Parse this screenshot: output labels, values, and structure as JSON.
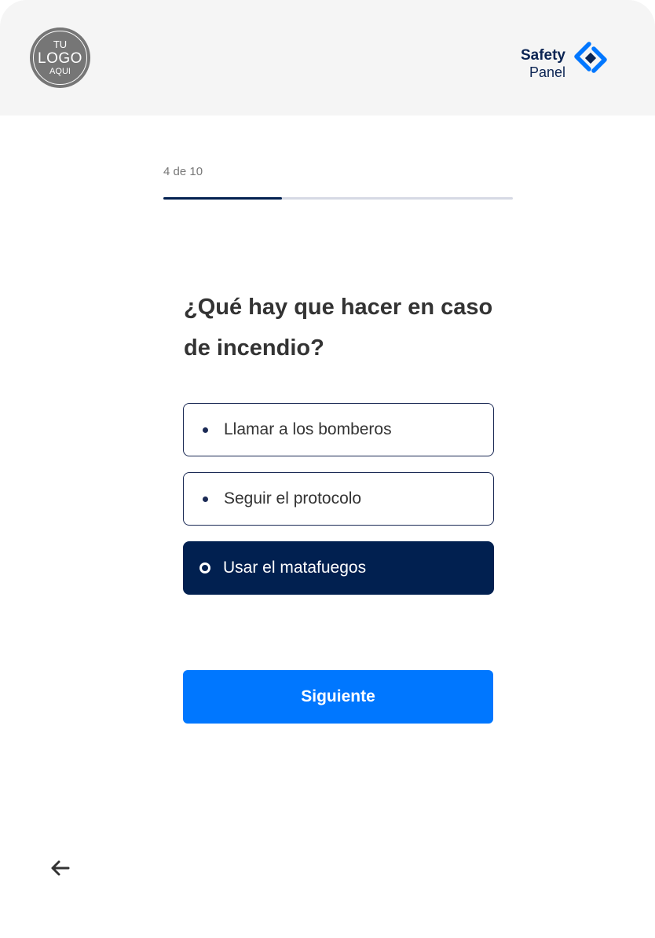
{
  "header": {
    "client_logo": {
      "line1": "TU",
      "line2": "LOGO",
      "line3": "AQUI"
    },
    "brand": {
      "name": "Safety",
      "sub": "Panel",
      "icon": "safety-panel-diamond-icon",
      "accent": "#0077ff"
    }
  },
  "progress": {
    "label": "4 de 10",
    "current": 4,
    "total": 10,
    "fraction": 0.34
  },
  "question": {
    "text": "¿Qué hay que hacer en caso de incendio?"
  },
  "options": [
    {
      "label": "Llamar a los bomberos",
      "selected": false
    },
    {
      "label": "Seguir el protocolo",
      "selected": false
    },
    {
      "label": "Usar el matafuegos",
      "selected": true
    }
  ],
  "actions": {
    "next_label": "Siguiente",
    "back_icon": "arrow-left-icon"
  },
  "colors": {
    "primary_dark": "#012050",
    "accent_blue": "#0077ff",
    "header_bg": "#f5f5f5",
    "text": "#333333"
  }
}
